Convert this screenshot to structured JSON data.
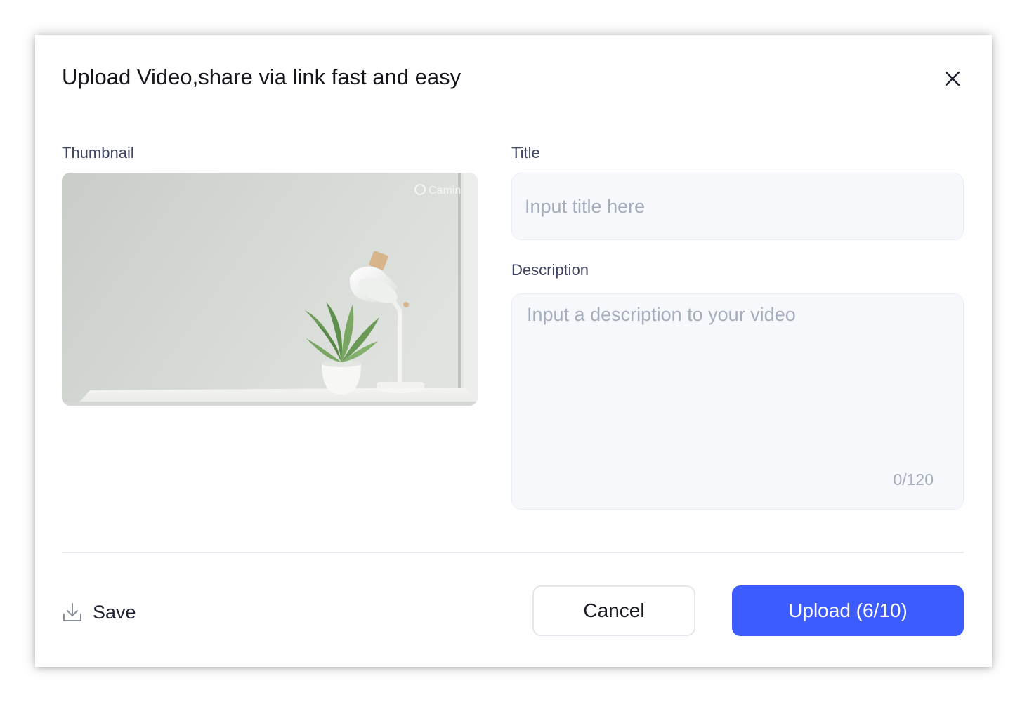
{
  "dialog": {
    "title": "Upload Video,share via link fast and easy",
    "close_icon": "close-icon"
  },
  "thumbnail": {
    "label": "Thumbnail",
    "image_description": "white desk with potted plant and desk lamp against light wall",
    "watermark": "Camin"
  },
  "title_field": {
    "label": "Title",
    "placeholder": "Input title here",
    "value": ""
  },
  "description_field": {
    "label": "Description",
    "placeholder": "Input a description to your video",
    "value": "",
    "char_count": "0/120"
  },
  "footer": {
    "save_label": "Save",
    "save_icon": "download-icon",
    "cancel_label": "Cancel",
    "upload_label": "Upload (6/10)"
  },
  "colors": {
    "primary": "#3d5cff",
    "field_bg": "#f6f8fc",
    "label_text": "#3d4361",
    "placeholder_text": "#a5acbc"
  }
}
